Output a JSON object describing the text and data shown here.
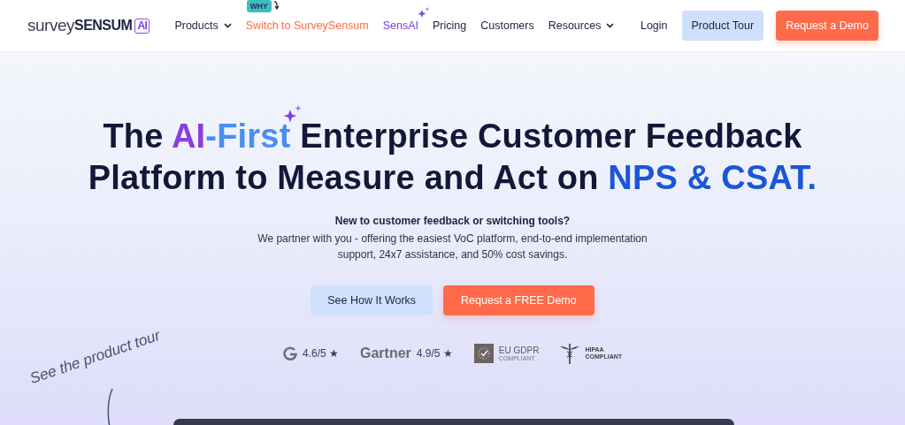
{
  "logo": {
    "light": "survey",
    "bold": "SENSUM",
    "badge": "AI"
  },
  "nav": [
    {
      "label": "Products",
      "kind": "dropdown"
    },
    {
      "label": "Switch to SurveySensum",
      "kind": "highlight",
      "badge": "WHY"
    },
    {
      "label": "SensAI",
      "kind": "ai"
    },
    {
      "label": "Pricing",
      "kind": "plain"
    },
    {
      "label": "Customers",
      "kind": "plain"
    },
    {
      "label": "Resources",
      "kind": "dropdown"
    }
  ],
  "actions": [
    {
      "label": "Login",
      "kind": "link"
    },
    {
      "label": "Product Tour",
      "kind": "secondary"
    },
    {
      "label": "Request a Demo",
      "kind": "primary"
    }
  ],
  "headline": [
    [
      {
        "text": "The ",
        "color": "#111838"
      },
      {
        "text": "AI",
        "color": "#8a3fd8"
      },
      {
        "text": "-First",
        "color": "#4a8ef0"
      },
      {
        "text": " Enterprise Customer Feedback",
        "color": "#111838"
      }
    ],
    [
      {
        "text": "Platform to Measure and Act on ",
        "color": "#111838"
      },
      {
        "text": "NPS & CSAT.",
        "color": "#1a56d8"
      }
    ]
  ],
  "subtitle_lead": "New to customer feedback or switching tools?",
  "subtitle": "We partner with you - offering the easiest VoC platform, end-to-end implementation support, 24x7 assistance, and 50% cost savings.",
  "cta": [
    {
      "label": "See How It Works",
      "kind": "secondary"
    },
    {
      "label": "Request a FREE Demo",
      "kind": "primary"
    }
  ],
  "ratings": [
    {
      "kind": "g2",
      "score": "4.6/5 ★"
    },
    {
      "kind": "gartner",
      "name": "Gartner",
      "score": "4.9/5 ★"
    },
    {
      "kind": "gdpr",
      "line1": "EU GDPR",
      "line2": "COMPLIANT"
    },
    {
      "kind": "hipaa",
      "line1": "HIPAA",
      "line2": "COMPLIANT"
    }
  ],
  "tour_note": "See the product tour"
}
